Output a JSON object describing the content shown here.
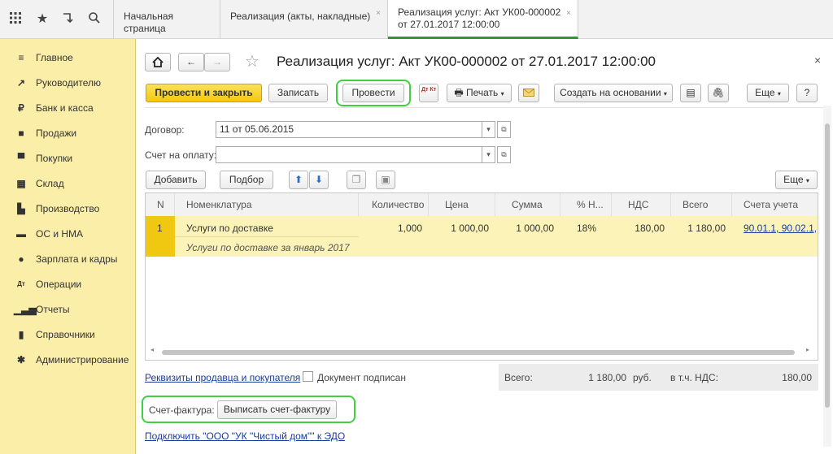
{
  "tabs": [
    {
      "label": "Начальная страница"
    },
    {
      "label": "Реализация (акты, накладные)",
      "close": "×"
    },
    {
      "label": "Реализация услуг: Акт УК00-000002 от 27.01.2017 12:00:00",
      "close": "×"
    }
  ],
  "sidebar": {
    "items": [
      {
        "label": "Главное",
        "icon": "menu-icon"
      },
      {
        "label": "Руководителю",
        "icon": "trend-icon"
      },
      {
        "label": "Банк и касса",
        "icon": "ruble-icon"
      },
      {
        "label": "Продажи",
        "icon": "bag-icon"
      },
      {
        "label": "Покупки",
        "icon": "cart-icon"
      },
      {
        "label": "Склад",
        "icon": "warehouse-icon"
      },
      {
        "label": "Производство",
        "icon": "factory-icon"
      },
      {
        "label": "ОС и НМА",
        "icon": "truck-icon"
      },
      {
        "label": "Зарплата и кадры",
        "icon": "person-icon"
      },
      {
        "label": "Операции",
        "icon": "dt-kt-icon"
      },
      {
        "label": "Отчеты",
        "icon": "bar-chart-icon"
      },
      {
        "label": "Справочники",
        "icon": "book-icon"
      },
      {
        "label": "Администрирование",
        "icon": "gear-icon"
      }
    ]
  },
  "form": {
    "title": "Реализация услуг: Акт УК00-000002 от 27.01.2017 12:00:00",
    "close": "×",
    "toolbar": {
      "post_close": "Провести и закрыть",
      "save": "Записать",
      "post": "Провести",
      "dtkt": "Дт Кт",
      "print": "Печать",
      "create_based": "Создать на основании",
      "more": "Еще",
      "help": "?"
    },
    "contract_label": "Договор:",
    "contract_value": "11 от 05.06.2015",
    "invoice_label": "Счет на оплату:",
    "invoice_value": "",
    "table_toolbar": {
      "add": "Добавить",
      "pick": "Подбор",
      "more": "Еще"
    },
    "table": {
      "headers": [
        "N",
        "Номенклатура",
        "Количество",
        "Цена",
        "Сумма",
        "% Н...",
        "НДС",
        "Всего",
        "Счета учета"
      ],
      "row": {
        "n": "1",
        "item": "Услуги по доставке",
        "content": "Услуги по доставке за январь 2017",
        "qty": "1,000",
        "price": "1 000,00",
        "sum": "1 000,00",
        "vat_rate": "18%",
        "vat": "180,00",
        "total": "1 180,00",
        "accounts": "90.01.1, 90.02.1,"
      }
    },
    "requisites_link": "Реквизиты продавца и покупателя",
    "signed_label": "Документ подписан",
    "totals": {
      "total_label": "Всего:",
      "total_value": "1 180,00",
      "currency": "руб.",
      "vat_label": "в т.ч. НДС:",
      "vat_value": "180,00"
    },
    "invoice_section": {
      "label": "Счет-фактура:",
      "button": "Выписать счет-фактуру"
    },
    "edo_link": "Подключить \"ООО \"УК \"Чистый дом\"\" к ЭДО"
  }
}
